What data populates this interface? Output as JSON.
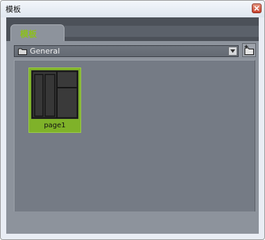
{
  "window": {
    "title": "模板",
    "close_icon": "close-icon"
  },
  "tabs": [
    {
      "label": "模板",
      "active": true
    }
  ],
  "toolbar": {
    "folder_select": {
      "value": "General",
      "icon": "folder-icon"
    },
    "dropdown_icon": "chevron-down-icon",
    "new_folder_icon": "new-folder-icon"
  },
  "templates": [
    {
      "name": "page1",
      "selected": true
    }
  ],
  "colors": {
    "accent": "#8cbf1f",
    "selection": "#7fb229",
    "panel": "#8d939c",
    "content": "#757b85"
  }
}
